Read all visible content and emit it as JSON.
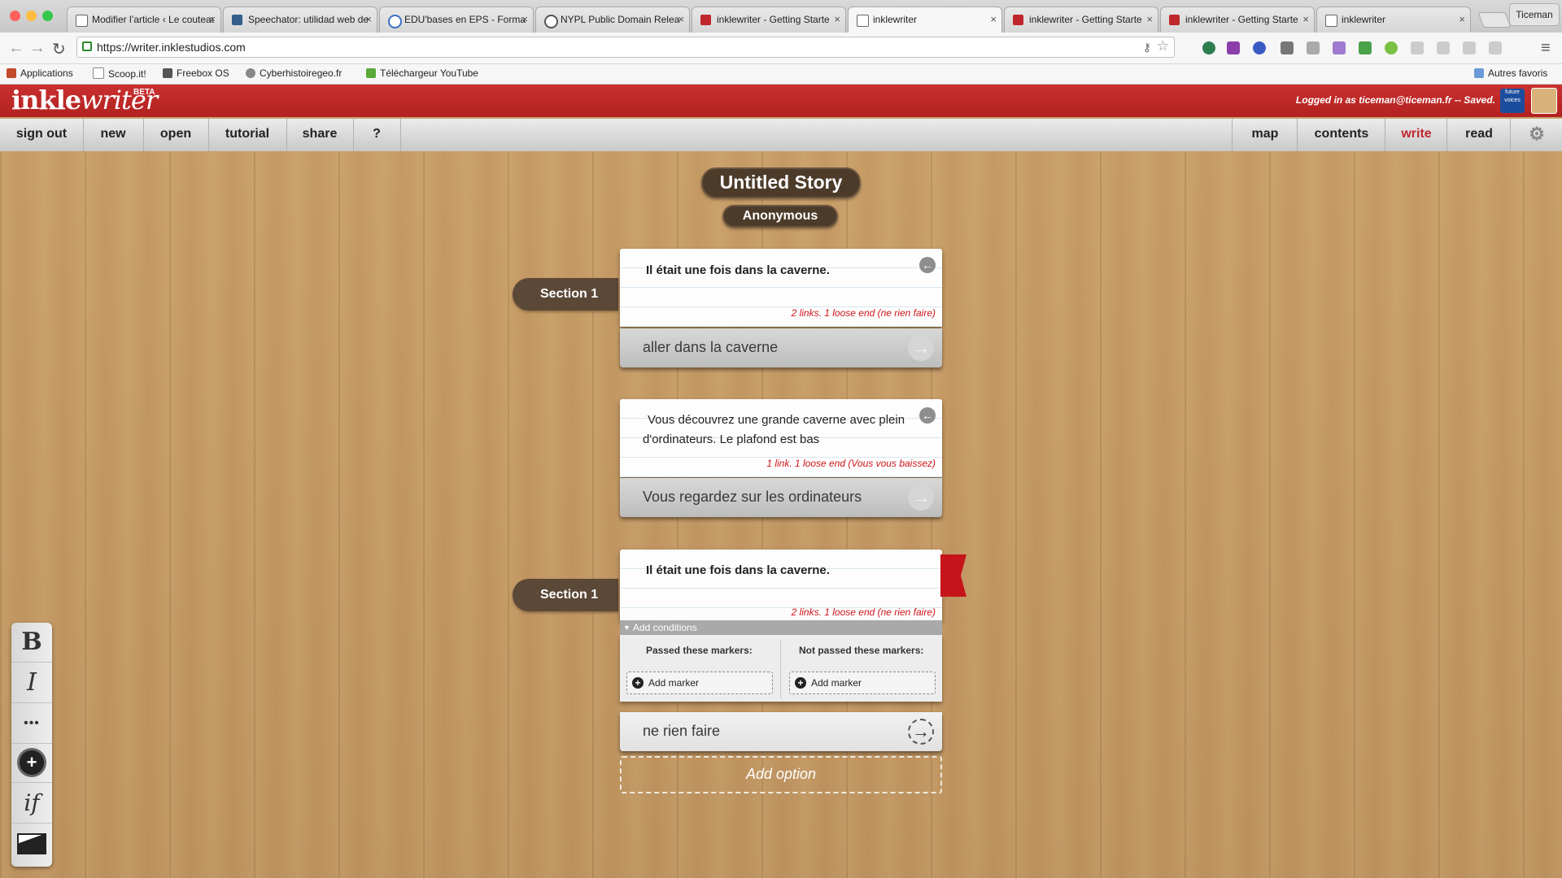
{
  "browser": {
    "tabs": [
      {
        "title": "Modifier l’article ‹ Le couteau",
        "color": "#6d6d6d"
      },
      {
        "title": "Speechator: utilidad web de",
        "color": "#335f8a"
      },
      {
        "title": "EDU'bases en EPS - Forma",
        "color": "#3a6fc4"
      },
      {
        "title": "NYPL Public Domain Relea",
        "color": "#555555"
      },
      {
        "title": "inklewriter - Getting Starte",
        "color": "#c0272d"
      },
      {
        "title": "inklewriter",
        "color": "#9a9a9a"
      },
      {
        "title": "inklewriter - Getting Starte",
        "color": "#c0272d"
      },
      {
        "title": "inklewriter - Getting Starte",
        "color": "#c0272d"
      },
      {
        "title": "inklewriter",
        "color": "#9a9a9a"
      }
    ],
    "profile": "Ticeman",
    "url": "https://writer.inklestudios.com",
    "bookmarks": [
      {
        "label": "Applications",
        "color": "#c34a2c"
      },
      {
        "label": "Scoop.it!",
        "color": "#bbbbbb"
      },
      {
        "label": "Freebox OS",
        "color": "#555555"
      },
      {
        "label": "Cyberhistoiregeo.fr",
        "color": "#888888"
      },
      {
        "label": "Téléchargeur YouTube",
        "color": "#5aa83a"
      }
    ],
    "other_bookmarks": "Autres favoris"
  },
  "app": {
    "logo_ink": "inkle",
    "logo_writer": "writer",
    "beta": "BETA",
    "status": "Logged in as ticeman@ticeman.fr -- Saved.",
    "fv_badge": "future voices",
    "menu_left": [
      "sign out",
      "new",
      "open",
      "tutorial",
      "share",
      "?"
    ],
    "menu_right": [
      "map",
      "contents",
      "write",
      "read"
    ],
    "active_menu": "write"
  },
  "story": {
    "title": "Untitled Story",
    "author": "Anonymous"
  },
  "paragraphs": [
    {
      "section": "Section 1",
      "text": "Il était une fois dans la caverne.",
      "links": "2 links. 1 loose end (ne rien faire)",
      "option": "aller dans la caverne"
    },
    {
      "section": "",
      "text": "Vous découvrez une grande caverne avec plein d'ordinateurs. Le plafond est bas",
      "links": "1 link. 1 loose end (Vous vous baissez)",
      "option": "Vous regardez sur les ordinateurs"
    },
    {
      "section": "Section 1",
      "text": "Il était une fois dans la caverne.",
      "links": "2 links. 1 loose end (ne rien faire)",
      "option": "ne rien faire"
    }
  ],
  "conditions": {
    "toggle": "Add conditions",
    "passed": "Passed these markers:",
    "not_passed": "Not passed these markers:",
    "add_marker": "Add marker"
  },
  "add_option": "Add option",
  "palette": [
    "B",
    "I",
    "•••",
    "+",
    "if",
    "image"
  ]
}
